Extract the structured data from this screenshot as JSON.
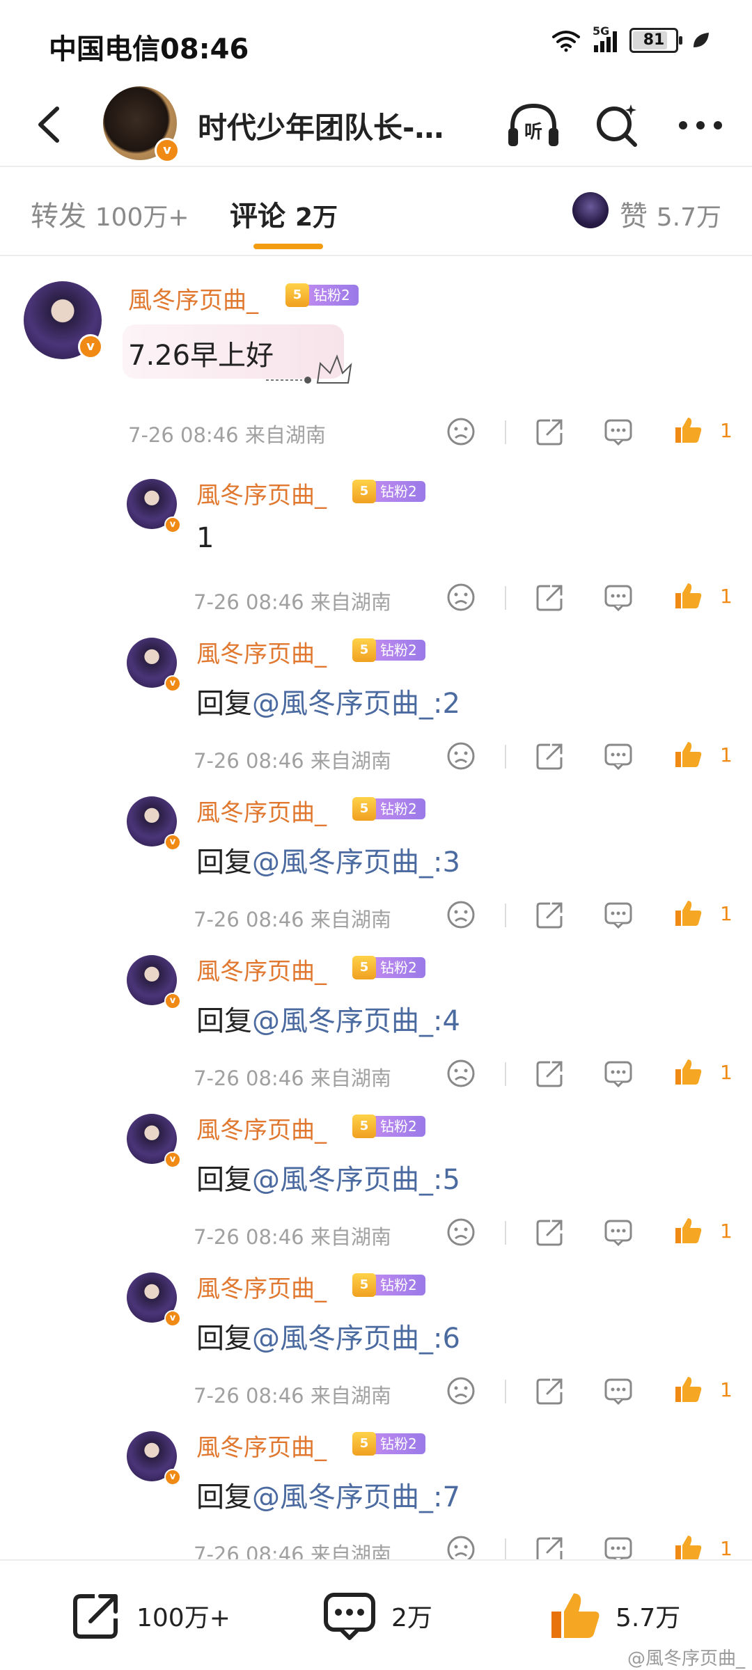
{
  "status_bar": {
    "carrier_time": "中国电信08:46",
    "network": "5G",
    "battery": "81",
    "battery_level": 0.81
  },
  "header": {
    "title": "时代少年团队长-…",
    "listen_label": "听"
  },
  "tabs": {
    "repost": {
      "label": "转发",
      "count": "100万+"
    },
    "comments": {
      "label": "评论",
      "count": "2万"
    },
    "likes": {
      "label": "赞",
      "count": "5.7万"
    }
  },
  "badge_level": "5",
  "comments": [
    {
      "username": "風冬序页曲_",
      "badge": "钻粉2",
      "content": "7.26早上好",
      "mention": "",
      "meta": "7-26 08:46 来自湖南",
      "likes": "1"
    },
    {
      "username": "風冬序页曲_",
      "badge": "钻粉2",
      "content": "1",
      "mention": "",
      "meta": "7-26 08:46 来自湖南",
      "likes": "1"
    },
    {
      "username": "風冬序页曲_",
      "badge": "钻粉2",
      "content": "回复",
      "mention": "@風冬序页曲_:2",
      "meta": "7-26 08:46 来自湖南",
      "likes": "1"
    },
    {
      "username": "風冬序页曲_",
      "badge": "钻粉2",
      "content": "回复",
      "mention": "@風冬序页曲_:3",
      "meta": "7-26 08:46 来自湖南",
      "likes": "1"
    },
    {
      "username": "風冬序页曲_",
      "badge": "钻粉2",
      "content": "回复",
      "mention": "@風冬序页曲_:4",
      "meta": "7-26 08:46 来自湖南",
      "likes": "1"
    },
    {
      "username": "風冬序页曲_",
      "badge": "钻粉2",
      "content": "回复",
      "mention": "@風冬序页曲_:5",
      "meta": "7-26 08:46 来自湖南",
      "likes": "1"
    },
    {
      "username": "風冬序页曲_",
      "badge": "钻粉2",
      "content": "回复",
      "mention": "@風冬序页曲_:6",
      "meta": "7-26 08:46 来自湖南",
      "likes": "1"
    },
    {
      "username": "風冬序页曲_",
      "badge": "钻粉2",
      "content": "回复",
      "mention": "@風冬序页曲_:7",
      "meta": "7-26 08:46 来自湖南",
      "likes": "1"
    }
  ],
  "bottom_bar": {
    "repost": "100万+",
    "comment": "2万",
    "like": "5.7万"
  },
  "watermark": "@風冬序页曲_",
  "colors": {
    "accent_orange": "#f39c12",
    "username_orange": "#e07830",
    "mention_blue": "#4b6aa0",
    "fan_badge_purple": "#b080ec"
  }
}
